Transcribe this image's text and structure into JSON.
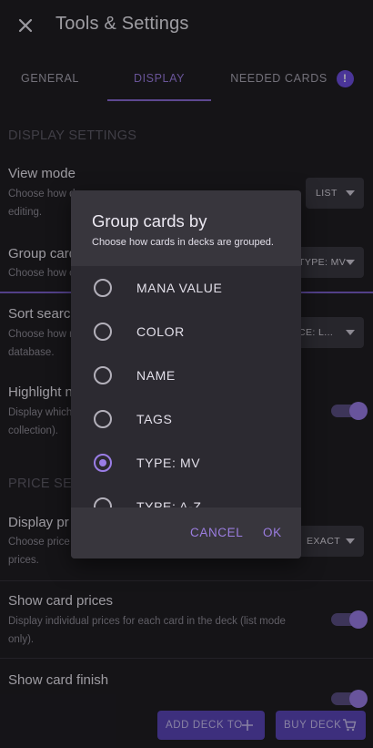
{
  "header": {
    "title": "Tools & Settings"
  },
  "tabs": [
    {
      "label": "GENERAL"
    },
    {
      "label": "DISPLAY"
    },
    {
      "label": "NEEDED CARDS",
      "badge": "!"
    }
  ],
  "display_settings": {
    "heading": "DISPLAY SETTINGS",
    "view_mode": {
      "title": "View mode",
      "desc_1": "Choose how d",
      "desc_2": "editing.",
      "value": "LIST"
    },
    "group_cards": {
      "title": "Group card",
      "desc": "Choose how c",
      "value": "TYPE: MV"
    },
    "sort_search": {
      "title": "Sort searc",
      "desc_1": "Choose how r",
      "desc_2": "database.",
      "value": "CE: L..."
    },
    "highlight": {
      "title": "Highlight n",
      "desc_1": "Display which",
      "desc_2": "collection).",
      "enabled": true
    }
  },
  "price_settings": {
    "heading": "PRICE SET",
    "display_price": {
      "title": "Display pr",
      "desc_1": "Choose price",
      "desc_2": "prices.",
      "value": "EXACT"
    },
    "show_prices": {
      "title": "Show card prices",
      "desc_1": "Display individual prices for each card in the deck (list mode",
      "desc_2": "only).",
      "enabled": true
    },
    "show_finish": {
      "title": "Show card finish",
      "enabled": true
    }
  },
  "footer": {
    "add_deck": "ADD DECK TO",
    "buy_deck": "BUY DECK"
  },
  "dialog": {
    "title": "Group cards by",
    "subtitle": "Choose how cards in decks are grouped.",
    "options": [
      {
        "label": "MANA VALUE",
        "selected": false
      },
      {
        "label": "COLOR",
        "selected": false
      },
      {
        "label": "NAME",
        "selected": false
      },
      {
        "label": "TAGS",
        "selected": false
      },
      {
        "label": "TYPE: MV",
        "selected": true
      },
      {
        "label": "TYPE: A-Z",
        "selected": false
      }
    ],
    "cancel": "CANCEL",
    "ok": "OK"
  },
  "colors": {
    "accent": "#9a7de6",
    "background": "#1f1e23",
    "dialog": "#2c2a31"
  },
  "icons": {
    "close": "close-icon",
    "badge": "alert-icon",
    "add": "plus-icon",
    "cart": "cart-icon",
    "dropdown": "chevron-down-icon"
  }
}
